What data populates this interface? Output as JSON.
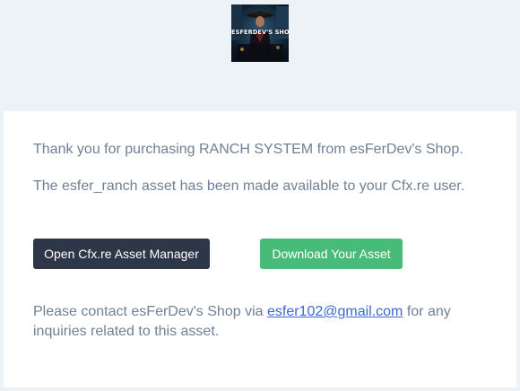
{
  "header": {
    "logo_text": "ESFERDEV'S SHOP"
  },
  "message": {
    "thanks_line": "Thank you for purchasing RANCH SYSTEM from esFerDev's Shop.",
    "availability_line": "The esfer_ranch asset has been made available to your Cfx.re user.",
    "contact_prefix": "Please contact esFerDev's Shop via ",
    "contact_email": "esfer102@gmail.com",
    "contact_suffix": " for any inquiries related to this asset."
  },
  "buttons": {
    "asset_manager_label": "Open Cfx.re Asset Manager",
    "download_label": "Download Your Asset"
  },
  "colors": {
    "page_background": "#edf2f7",
    "body_text": "#718096",
    "dark_button": "#2d3748",
    "green_button": "#48bb78",
    "link": "#3869d4"
  }
}
